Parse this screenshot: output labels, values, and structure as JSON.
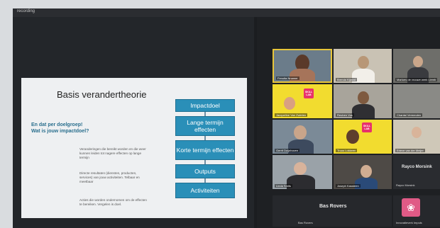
{
  "window": {
    "title": "recording"
  },
  "slide": {
    "title": "Basis verandertheorie",
    "question_line1": "En dat per doelgroep!",
    "question_line2": "Wat is jouw impactdoel?",
    "boxes": [
      "Impactdoel",
      "Lange termijn effecten",
      "Korte termijn effecten",
      "Outputs",
      "Activiteiten"
    ],
    "descriptions": [
      "Veranderingen die bereikt worden en die weer kunnen leiden tot nagere effecten op lange termijn",
      "Directe resultaten (diensten, producten, services) van jouw activiteiten. Telbaar en meetbaar",
      "Acties die worden ondernomen om de effecten te bereiken. Vergelen is doel."
    ]
  },
  "participants": [
    "Fenuita Nnamer",
    "Brenda Kijland",
    "Marloes de vrouwe werk Liemb",
    "Jacqueline Van Zwieten",
    "Reuben Vos",
    "Chantal Vermeulen",
    "Gerrit Duijnhoven",
    "Truus Lokkeen",
    "Erieve van der Meijer",
    "Linda Smits",
    "Joseph Kassteen",
    "Rayco Morsink"
  ],
  "bottom": {
    "rayco_big": "Rayco Morsink",
    "rayco_small": "Rayco Morsink",
    "bas_big": "Bas Rovers",
    "bas_small": "Bas Rovers",
    "impact_label": "Innovatieverk Impuls"
  },
  "logo_text": "SKILL LAB",
  "colors": {
    "box": "#2a8fb8",
    "accent_yellow": "#f2dc2f",
    "active_border": "#e8c53a"
  }
}
